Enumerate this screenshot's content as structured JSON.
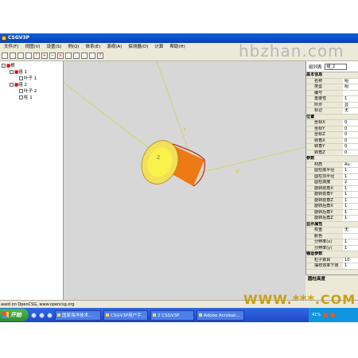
{
  "window": {
    "title": "CSGV3P"
  },
  "watermark": "hbzhan.com",
  "watermark2": "WWW.***.COM",
  "menu": [
    "文件(F)",
    "视图(V)",
    "设置(S)",
    "例(Q)",
    "体系(E)",
    "源视(A)",
    "探测器(D)",
    "计算",
    "帮助(H)"
  ],
  "tree": [
    {
      "label": "根",
      "level": 0
    },
    {
      "label": "组 1",
      "level": 1
    },
    {
      "label": "叶子 1",
      "level": 2
    },
    {
      "label": "组 2",
      "level": 1
    },
    {
      "label": "叶子 2",
      "level": 2
    },
    {
      "label": "柱 1",
      "level": 2
    }
  ],
  "viewport": {
    "axis_y": "Y",
    "axis_x": "X",
    "axis_z": "Z"
  },
  "panel": {
    "group_list_label": "组列表",
    "group_selected": "组_2",
    "categories": [
      {
        "name": "基本信息",
        "rows": [
          [
            "名称",
            "组"
          ],
          [
            "类型",
            "组"
          ],
          [
            "编号",
            ""
          ],
          [
            "重要性",
            "1"
          ],
          [
            "所示",
            "显"
          ],
          [
            "标记",
            "无"
          ]
        ]
      },
      {
        "name": "位置",
        "rows": [
          [
            "坐标X",
            "0"
          ],
          [
            "坐标Y",
            "0"
          ],
          [
            "坐标Z",
            "0"
          ],
          [
            "转角X",
            "0"
          ],
          [
            "转角Y",
            "0"
          ],
          [
            "转角Z",
            "0"
          ]
        ]
      },
      {
        "name": "参数",
        "rows": [
          [
            "材质",
            "Au"
          ],
          [
            "圆柱底半径",
            "1"
          ],
          [
            "圆柱顶半径",
            "1"
          ],
          [
            "圆柱高度",
            "2"
          ],
          [
            "旋转前角X",
            "1"
          ],
          [
            "旋转前角Y",
            "1"
          ],
          [
            "旋转前角Z",
            "1"
          ],
          [
            "旋转后角X",
            "1"
          ],
          [
            "旋转后角Y",
            "1"
          ],
          [
            "旋转后角Z",
            "1"
          ]
        ]
      },
      {
        "name": "显示属性",
        "rows": [
          [
            "权重",
            "无"
          ],
          [
            "颜色",
            ""
          ],
          [
            "分辨率(x)",
            "1"
          ],
          [
            "分辨率(y)",
            "1"
          ]
        ]
      },
      {
        "name": "输运参数",
        "rows": [
          [
            "粒子数目",
            "10"
          ],
          [
            "抽样效率下限",
            "1"
          ]
        ]
      }
    ],
    "status_label": "圆柱高度"
  },
  "footer_text": "ased on OpenCSG, www.opencsg.org",
  "taskbar": {
    "start": "开始",
    "tasks": [
      "国家海洋技术...",
      "CSGV3P用户手...",
      "2 CSGV3P",
      "Adobe Acrobat..."
    ],
    "tray_text": "41%"
  }
}
